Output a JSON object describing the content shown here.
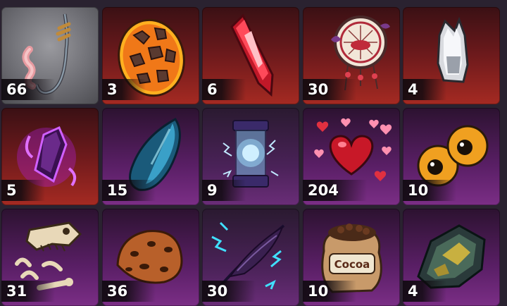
{
  "inventory": {
    "items": [
      {
        "name": "worm-hook",
        "count": "66",
        "icon": "fishing-hook-with-worm-icon"
      },
      {
        "name": "lava-egg",
        "count": "3",
        "icon": "lava-egg-icon"
      },
      {
        "name": "red-crystal",
        "count": "6",
        "icon": "red-crystal-shard-icon"
      },
      {
        "name": "dreamcatcher",
        "count": "30",
        "icon": "dreamcatcher-icon"
      },
      {
        "name": "silver-chunk",
        "count": "4",
        "icon": "silver-ore-chunk-icon"
      },
      {
        "name": "void-crystal",
        "count": "5",
        "icon": "purple-glowing-crystal-icon"
      },
      {
        "name": "blue-seed",
        "count": "15",
        "icon": "blue-seed-icon"
      },
      {
        "name": "energy-capsule",
        "count": "9",
        "icon": "lightning-capsule-icon"
      },
      {
        "name": "love-hearts",
        "count": "204",
        "icon": "hearts-icon"
      },
      {
        "name": "eyeballs",
        "count": "10",
        "icon": "orange-eyeballs-icon"
      },
      {
        "name": "fossil",
        "count": "31",
        "icon": "dinosaur-fossil-icon"
      },
      {
        "name": "cookie",
        "count": "36",
        "icon": "chocolate-chip-cookie-icon"
      },
      {
        "name": "storm-feather",
        "count": "30",
        "icon": "storm-feather-icon"
      },
      {
        "name": "cocoa-sack",
        "count": "10",
        "icon": "cocoa-sack-icon",
        "sack_label": "Cocoa"
      },
      {
        "name": "gold-ore",
        "count": "4",
        "icon": "gold-ore-rock-icon"
      }
    ]
  }
}
